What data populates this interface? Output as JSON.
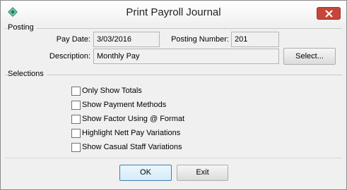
{
  "window": {
    "title": "Print Payroll Journal",
    "icon": "payroll-app-icon",
    "close_icon": "close-icon"
  },
  "posting": {
    "group_label": "Posting",
    "pay_date_label": "Pay Date:",
    "pay_date_value": "3/03/2016",
    "posting_number_label": "Posting Number:",
    "posting_number_value": "201",
    "description_label": "Description:",
    "description_value": "Monthly Pay",
    "select_button": "Select..."
  },
  "selections": {
    "group_label": "Selections",
    "options": [
      {
        "label": "Only Show Totals",
        "checked": false
      },
      {
        "label": "Show Payment Methods",
        "checked": false
      },
      {
        "label": "Show Factor Using @ Format",
        "checked": false
      },
      {
        "label": "Highlight Nett Pay Variations",
        "checked": false
      },
      {
        "label": "Show Casual Staff Variations",
        "checked": false
      }
    ]
  },
  "buttons": {
    "ok": "OK",
    "exit": "Exit"
  },
  "colors": {
    "close_button": "#c7463a",
    "default_button_border": "#3c7fb1"
  }
}
